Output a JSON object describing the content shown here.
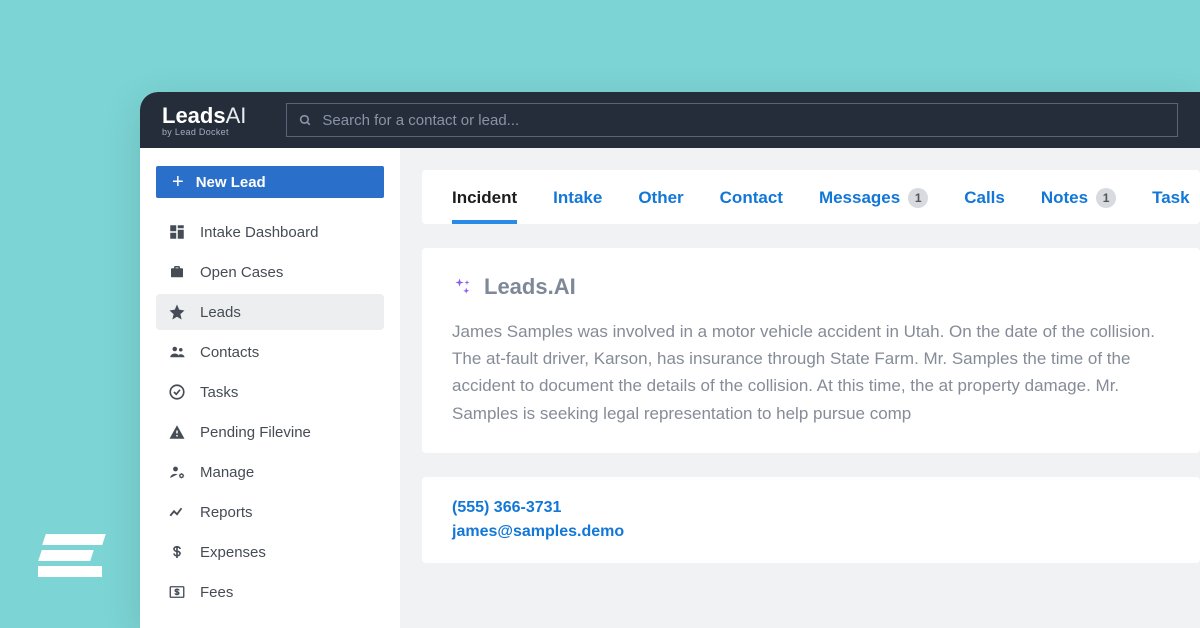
{
  "brand": {
    "main_bold": "Leads",
    "main_thin": "AI",
    "subtitle": "by Lead Docket"
  },
  "search": {
    "placeholder": "Search for a contact or lead..."
  },
  "sidebar": {
    "new_lead_label": "New Lead",
    "items": [
      {
        "label": "Intake Dashboard",
        "icon": "dashboard"
      },
      {
        "label": "Open Cases",
        "icon": "briefcase"
      },
      {
        "label": "Leads",
        "icon": "star",
        "active": true
      },
      {
        "label": "Contacts",
        "icon": "people"
      },
      {
        "label": "Tasks",
        "icon": "check-circle"
      },
      {
        "label": "Pending Filevine",
        "icon": "warning"
      },
      {
        "label": "Manage",
        "icon": "user-cog"
      },
      {
        "label": "Reports",
        "icon": "trend"
      },
      {
        "label": "Expenses",
        "icon": "dollar"
      },
      {
        "label": "Fees",
        "icon": "dollar-box"
      }
    ]
  },
  "tabs": [
    {
      "label": "Incident",
      "active": true
    },
    {
      "label": "Intake"
    },
    {
      "label": "Other"
    },
    {
      "label": "Contact"
    },
    {
      "label": "Messages",
      "badge": "1"
    },
    {
      "label": "Calls"
    },
    {
      "label": "Notes",
      "badge": "1"
    },
    {
      "label": "Task"
    }
  ],
  "summary": {
    "title": "Leads.AI",
    "body": "James Samples was involved in a motor vehicle accident in Utah. On the date of the collision. The at-fault driver, Karson, has insurance through State Farm. Mr. Samples the time of the accident to document the details of the collision. At this time, the at property damage. Mr. Samples is seeking legal representation to help pursue comp"
  },
  "contact": {
    "phone": "(555) 366-3731",
    "email": "james@samples.demo"
  }
}
